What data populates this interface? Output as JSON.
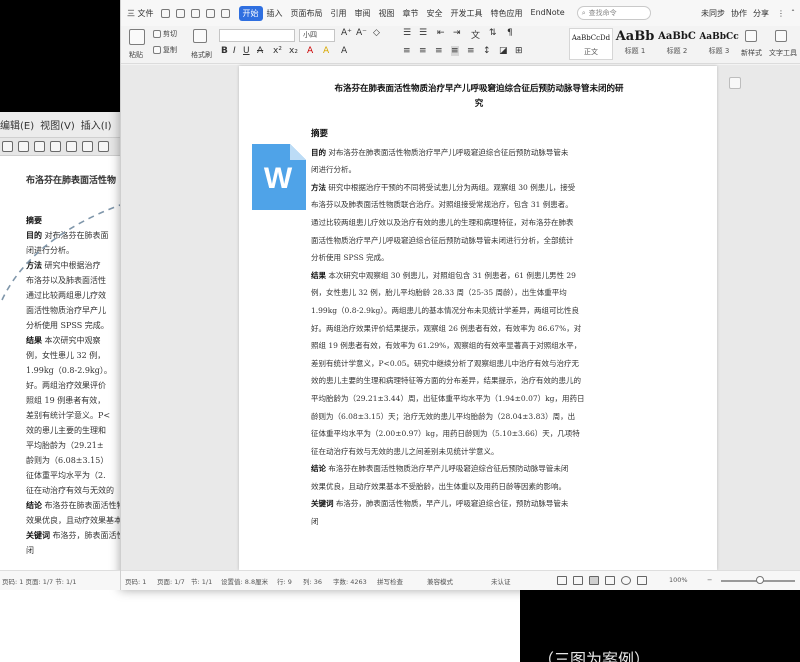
{
  "back_window": {
    "menu": [
      "编辑(E)",
      "视图(V)",
      "插入(I)"
    ],
    "doc_title": "布洛芬在肺表面活性物",
    "lines": [
      {
        "label": "摘要",
        "text": ""
      },
      {
        "label": "目的",
        "text": "对布洛芬在肺表面"
      },
      {
        "label": "",
        "text": "闭进行分析。"
      },
      {
        "label": "方法",
        "text": "研究中根据治疗"
      },
      {
        "label": "",
        "text": "布洛芬以及肺表面活性"
      },
      {
        "label": "",
        "text": "通过比较两组患儿疗效"
      },
      {
        "label": "",
        "text": "面活性物质治疗早产儿"
      },
      {
        "label": "",
        "text": "分析使用 SPSS 完成。"
      },
      {
        "label": "结果",
        "text": "本次研究中观察"
      },
      {
        "label": "",
        "text": "例，女性患儿 32 例，"
      },
      {
        "label": "",
        "text": "1.99kg（0.8-2.9kg）。"
      },
      {
        "label": "",
        "text": "好。两组治疗效果评价"
      },
      {
        "label": "",
        "text": "照组 19 例患者有效，"
      },
      {
        "label": "",
        "text": "差别有统计学意义。P<"
      },
      {
        "label": "",
        "text": "效的患儿主要的生理和"
      },
      {
        "label": "",
        "text": "平均胎龄为（29.21±"
      },
      {
        "label": "",
        "text": "龄则为（6.08±3.15）"
      },
      {
        "label": "",
        "text": "征体重平均水平为（2."
      },
      {
        "label": "",
        "text": "征在动治疗有效与无效的"
      },
      {
        "label": "结论",
        "text": "布洛芬在肺表面活性物质在早产儿呼吸窘迫"
      },
      {
        "label": "",
        "text": "效果优良，且动疗效果基本不受胎龄，出生体重以及用药日龄等因素的影响。"
      },
      {
        "label": "关键词",
        "text": "布洛芬，肺表面活性物质，早产儿，呼吸窘迫综合征，预防动脉导管未"
      },
      {
        "label": "",
        "text": "闭"
      }
    ],
    "status": "页码: 1   页面: 1/7   节: 1/1"
  },
  "menubar": {
    "file": "三 文件",
    "tabs": [
      "开始",
      "插入",
      "页面布局",
      "引用",
      "审阅",
      "视图",
      "章节",
      "安全",
      "开发工具",
      "特色应用",
      "EndNote"
    ],
    "active_tab": "开始",
    "search": "查找命令",
    "right": [
      "未同步",
      "协作",
      "分享"
    ]
  },
  "ribbon": {
    "paste": "粘贴",
    "cut": "剪切",
    "copy": "复制",
    "format_painter": "格式刷",
    "font_size": "小四",
    "styles": [
      {
        "preview": "AaBbCcDd",
        "caption": "正文"
      },
      {
        "preview": "AaBb",
        "caption": "标题 1"
      },
      {
        "preview": "AaBbC",
        "caption": "标题 2"
      },
      {
        "preview": "AaBbCc",
        "caption": "标题 3"
      }
    ],
    "new_style": "新样式",
    "text_tools": "文字工具"
  },
  "document": {
    "title_line1": "布洛芬在肺表面活性物质治疗早产儿呼吸窘迫综合征后预防动脉导管未闭的研",
    "title_line2": "究",
    "heading": "摘要",
    "lines": [
      {
        "label": "目的",
        "text": "对布洛芬在肺表面活性物质治疗早产儿呼吸窘迫综合征后预防动脉导管未"
      },
      {
        "label": "",
        "text": "闭进行分析。"
      },
      {
        "label": "方法",
        "text": "研究中根据治疗干预的不同将受试患儿分为两组。观察组 30 例患儿，接受"
      },
      {
        "label": "",
        "text": "布洛芬以及肺表面活性物质联合治疗。对照组接受常规治疗，包含 31 例患者。"
      },
      {
        "label": "",
        "text": "通过比较两组患儿疗效以及治疗有效的患儿的生理和病理特征，对布洛芬在肺表"
      },
      {
        "label": "",
        "text": "面活性物质治疗早产儿呼吸窘迫综合征后预防动脉导管未闭进行分析，全部统计"
      },
      {
        "label": "",
        "text": "分析使用 SPSS 完成。"
      },
      {
        "label": "结果",
        "text": "本次研究中观察组 30 例患儿，对照组包含 31 例患者，61 例患儿男性 29"
      },
      {
        "label": "",
        "text": "例，女性患儿 32 例，胎儿平均胎龄 28.33 周（25-35 周龄），出生体重平均"
      },
      {
        "label": "",
        "text": "1.99kg（0.8-2.9kg）。两组患儿的基本情况分布未见统计学差异，两组可比性良"
      },
      {
        "label": "",
        "text": "好。两组治疗效果评价结果提示，观察组 26 例患者有效，有效率为 86.67%，对"
      },
      {
        "label": "",
        "text": "照组 19 例患者有效，有效率为 61.29%，观察组的有效率显著高于对照组水平，"
      },
      {
        "label": "",
        "text": "差别有统计学意义，P<0.05。研究中继续分析了观察组患儿中治疗有效与治疗无"
      },
      {
        "label": "",
        "text": "效的患儿主要的生理和病理特征等方面的分布差异，结果提示，治疗有效的患儿的"
      },
      {
        "label": "",
        "text": "平均胎龄为（29.21±3.44）周，出征体重平均水平为（1.94±0.07）kg，用药日"
      },
      {
        "label": "",
        "text": "龄则为（6.08±3.15）天；治疗无效的患儿平均胎龄为（28.04±3.83）周，出"
      },
      {
        "label": "",
        "text": "征体重平均水平为（2.00±0.97）kg，用药日龄则为（5.10±3.66）天，几项特"
      },
      {
        "label": "",
        "text": "征在动治疗有效与无效的患儿之间差别未见统计学意义。"
      },
      {
        "label": "结论",
        "text": "布洛芬在肺表面活性物质治疗早产儿呼吸窘迫综合征后预防动脉导管未闭"
      },
      {
        "label": "",
        "text": "效果优良，且动疗效果基本不受胎龄，出生体重以及用药日龄等因素的影响。"
      },
      {
        "label": "关键词",
        "text": "布洛芬，肺表面活性物质，早产儿，呼吸窘迫综合征，预防动脉导管未"
      },
      {
        "label": "",
        "text": "闭"
      }
    ]
  },
  "statusbar": {
    "items": [
      "页码: 1",
      "页面: 1/7",
      "节: 1/1",
      "设置值: 8.8厘米",
      "行: 9",
      "列: 36",
      "字数: 4263",
      "拼写检查",
      "兼容模式",
      "未认证"
    ],
    "zoom": "100%"
  },
  "word_icon_letter": "W",
  "caption": "（三图为案例）",
  "colors": {
    "accent": "#2f6fe0",
    "word_icon": "#4fa3e8",
    "word_icon_fold": "#bcdcf6"
  }
}
